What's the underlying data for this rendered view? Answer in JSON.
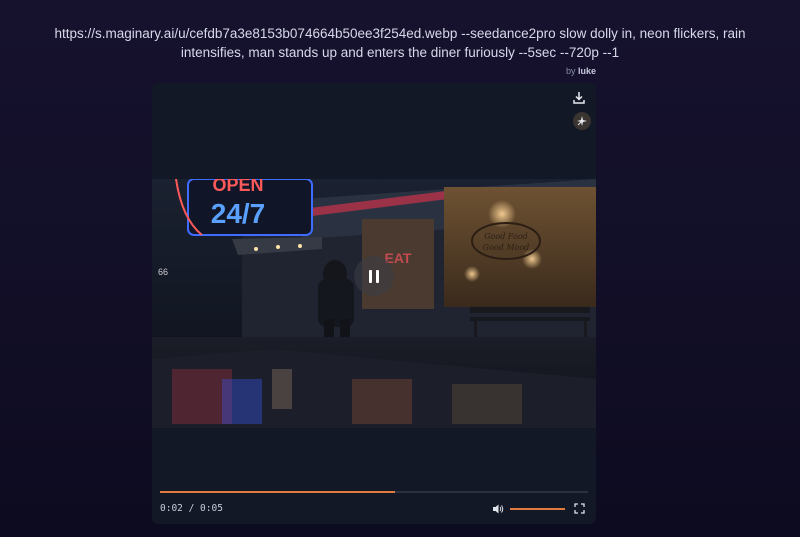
{
  "prompt": {
    "line1": "https://s.maginary.ai/u/cefdb7a3e8153b074664b50ee3f254ed.webp --seedance2pro slow dolly in, neon flickers, rain",
    "line2": "intensifies, man stands up and enters the diner furiously --5sec --720p --1"
  },
  "byline": {
    "prefix": "by",
    "author": "luke"
  },
  "player": {
    "time_label": "0:02 / 0:05",
    "progress_fraction": 0.55,
    "volume_fraction": 1.0,
    "state": "playing",
    "accent": "#e07b3f"
  },
  "scene": {
    "sign_text_1": "OPEN",
    "sign_text_2": "24/7",
    "window_sign_1": "Good Food",
    "window_sign_2": "Good Mood",
    "eat_sign": "EAT",
    "route_sign": "66"
  },
  "icons": {
    "download": "download-icon",
    "magic": "magic-sparkle-icon",
    "pause": "pause-icon",
    "volume": "volume-icon",
    "fullscreen": "fullscreen-icon"
  }
}
